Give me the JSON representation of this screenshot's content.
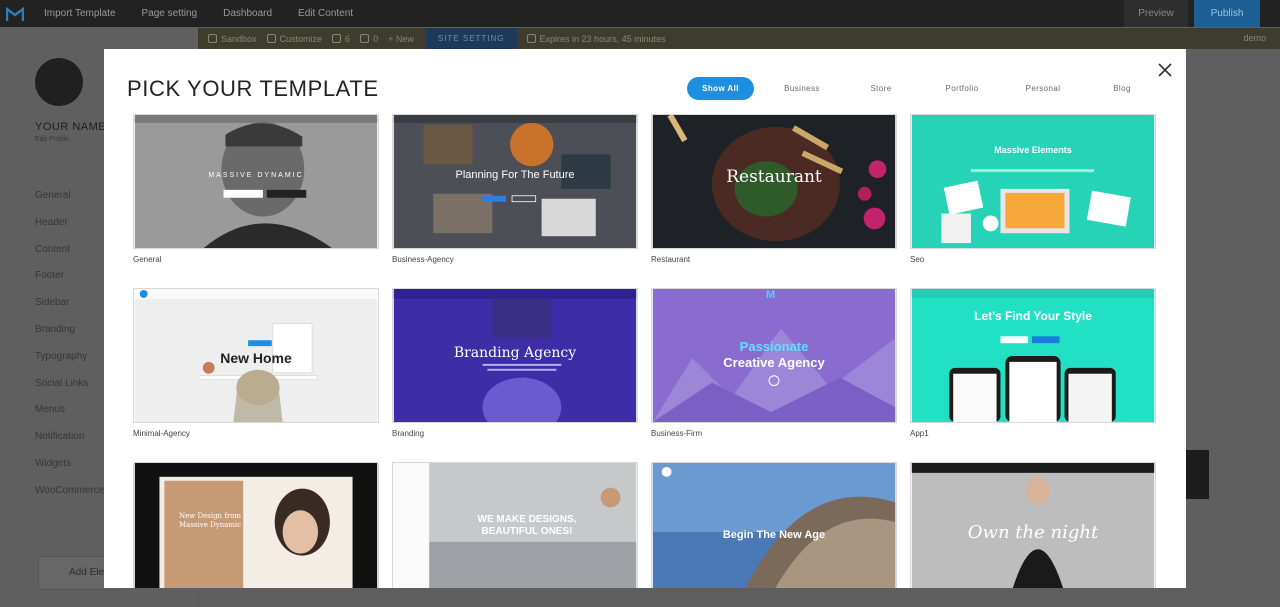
{
  "topbar": {
    "menu": [
      "Import Template",
      "Page setting",
      "Dashboard",
      "Edit Content"
    ],
    "preview": "Preview",
    "publish": "Publish"
  },
  "wpbar": {
    "sandbox": "Sandbox",
    "customize": "Customize",
    "updates": "6",
    "comments": "0",
    "new": "New",
    "site_setting": "SITE SETTING",
    "expires": "Expires in 23 hours, 45 minutes",
    "user": "demo"
  },
  "sidebar": {
    "name": "YOUR NAME",
    "edit_profile": "Edit Profile",
    "items": [
      "General",
      "Header",
      "Content",
      "Footer",
      "Sidebar",
      "Branding",
      "Typography",
      "Social Links",
      "Menus",
      "Notification",
      "Widgets",
      "WooCommerce"
    ],
    "add_element": "Add Element"
  },
  "modal": {
    "title": "PICK YOUR TEMPLATE",
    "filters": [
      "Show All",
      "Business",
      "Store",
      "Portfolio",
      "Personal",
      "Blog"
    ],
    "active_filter": "Show All",
    "accent_color": "#1e8fe0"
  },
  "templates": [
    {
      "label": "General",
      "headline": "MASSIVE DYNAMIC"
    },
    {
      "label": "Business-Agency",
      "headline": "Planning For The Future"
    },
    {
      "label": "Restaurant",
      "headline": "Restaurant"
    },
    {
      "label": "Seo",
      "headline": "Massive Elements"
    },
    {
      "label": "Minimal-Agency",
      "headline": "New Home"
    },
    {
      "label": "Branding",
      "headline": "Branding Agency"
    },
    {
      "label": "Business-Firm",
      "headline": "Passionate",
      "headline2": "Creative Agency"
    },
    {
      "label": "App1",
      "headline": "Let's Find Your Style"
    },
    {
      "label": "",
      "headline": "New Design from",
      "headline2": "Massive Dynamic"
    },
    {
      "label": "",
      "headline": "WE MAKE DESIGNS,",
      "headline2": "BEAUTIFUL ONES!"
    },
    {
      "label": "",
      "headline": "Begin The New Age"
    },
    {
      "label": "",
      "headline": "Own the night"
    }
  ]
}
